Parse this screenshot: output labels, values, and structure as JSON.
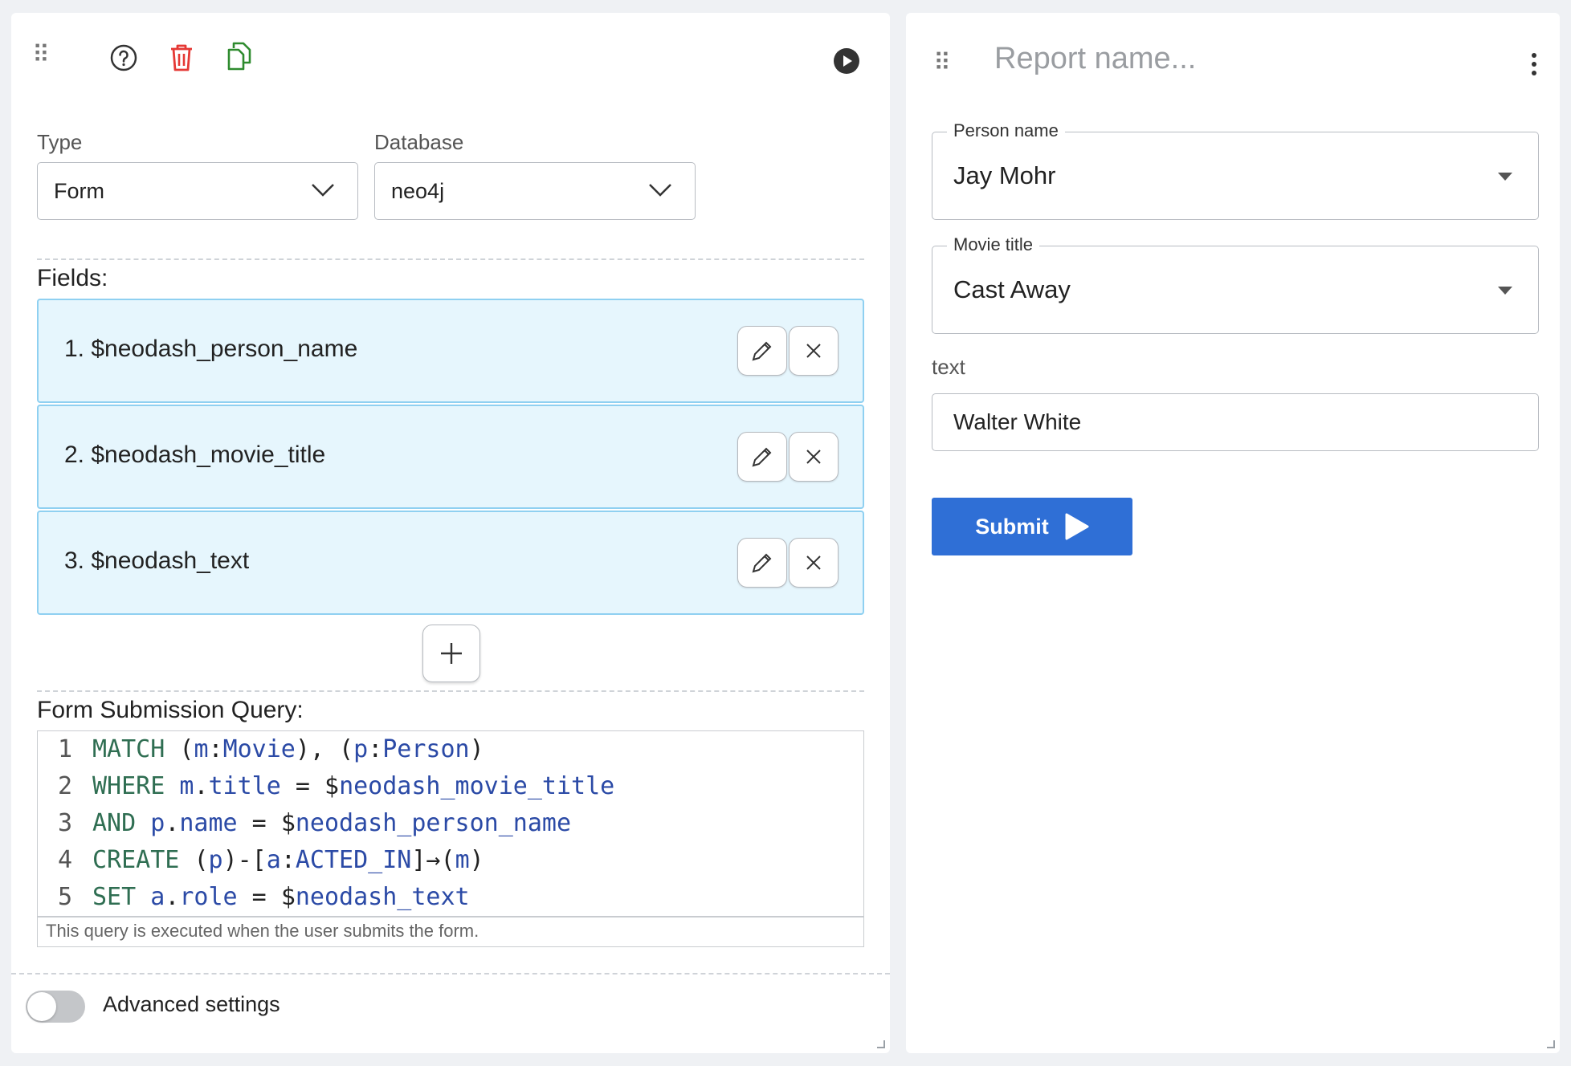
{
  "editor": {
    "type_label": "Type",
    "type_value": "Form",
    "database_label": "Database",
    "database_value": "neo4j",
    "fields_title": "Fields:",
    "fields": [
      {
        "label": "1. $neodash_person_name"
      },
      {
        "label": "2. $neodash_movie_title"
      },
      {
        "label": "3. $neodash_text"
      }
    ],
    "query_title": "Form Submission Query:",
    "query_lines": [
      {
        "n": "1",
        "tokens": [
          [
            "kw",
            "MATCH "
          ],
          [
            "pun",
            "("
          ],
          [
            "var",
            "m"
          ],
          [
            "pun",
            ":"
          ],
          [
            "var",
            "Movie"
          ],
          [
            "pun",
            "), ("
          ],
          [
            "var",
            "p"
          ],
          [
            "pun",
            ":"
          ],
          [
            "var",
            "Person"
          ],
          [
            "pun",
            ")"
          ]
        ]
      },
      {
        "n": "2",
        "tokens": [
          [
            "kw",
            "WHERE "
          ],
          [
            "var",
            "m"
          ],
          [
            "pun",
            "."
          ],
          [
            "var",
            "title"
          ],
          [
            "pun",
            " = "
          ],
          [
            "pun",
            "$"
          ],
          [
            "var",
            "neodash_movie_title"
          ]
        ]
      },
      {
        "n": "3",
        "tokens": [
          [
            "kw",
            "AND "
          ],
          [
            "var",
            "p"
          ],
          [
            "pun",
            "."
          ],
          [
            "var",
            "name"
          ],
          [
            "pun",
            " = "
          ],
          [
            "pun",
            "$"
          ],
          [
            "var",
            "neodash_person_name"
          ]
        ]
      },
      {
        "n": "4",
        "tokens": [
          [
            "kw",
            "CREATE "
          ],
          [
            "pun",
            "("
          ],
          [
            "var",
            "p"
          ],
          [
            "pun",
            ")-["
          ],
          [
            "var",
            "a"
          ],
          [
            "pun",
            ":"
          ],
          [
            "var",
            "ACTED_IN"
          ],
          [
            "pun",
            "]→("
          ],
          [
            "var",
            "m"
          ],
          [
            "pun",
            ")"
          ]
        ]
      },
      {
        "n": "5",
        "tokens": [
          [
            "kw",
            "SET "
          ],
          [
            "var",
            "a"
          ],
          [
            "pun",
            "."
          ],
          [
            "var",
            "role"
          ],
          [
            "pun",
            " = "
          ],
          [
            "pun",
            "$"
          ],
          [
            "var",
            "neodash_text"
          ]
        ]
      }
    ],
    "query_hint": "This query is executed when the user submits the form.",
    "advanced_label": "Advanced settings",
    "advanced_enabled": false
  },
  "report": {
    "name_placeholder": "Report name...",
    "person_label": "Person name",
    "person_value": "Jay Mohr",
    "movie_label": "Movie title",
    "movie_value": "Cast Away",
    "text_label": "text",
    "text_value": "Walter White",
    "submit_label": "Submit"
  },
  "colors": {
    "accent": "#2f6fd6",
    "delete": "#e53935",
    "copy": "#2e8b2e",
    "field_bg": "#e6f6fd",
    "field_border": "#8fd0f1"
  },
  "icons": [
    "drag-handle-icon",
    "help-icon",
    "delete-icon",
    "copy-icon",
    "run-icon",
    "more-vert-icon",
    "pencil-icon",
    "close-icon",
    "plus-icon",
    "play-icon",
    "chevron-down-icon"
  ]
}
